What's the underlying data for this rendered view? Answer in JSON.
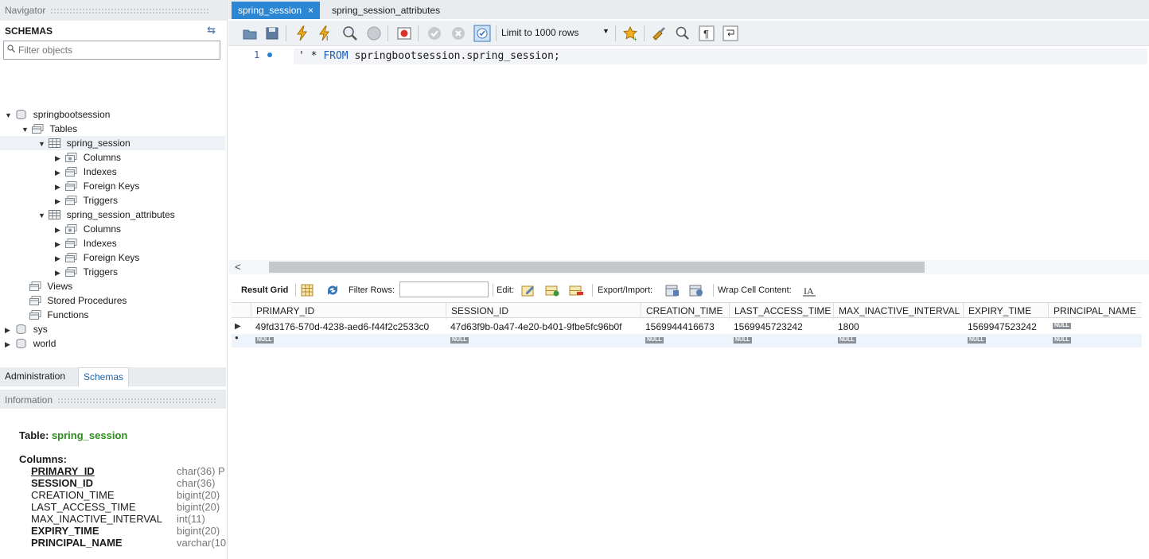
{
  "navigator": {
    "title": "Navigator",
    "schemas_label": "SCHEMAS",
    "filter_placeholder": "Filter objects",
    "tree": {
      "db1": "springbootsession",
      "tables": "Tables",
      "t1": "spring_session",
      "t1_children": [
        "Columns",
        "Indexes",
        "Foreign Keys",
        "Triggers"
      ],
      "t2": "spring_session_attributes",
      "t2_children": [
        "Columns",
        "Indexes",
        "Foreign Keys",
        "Triggers"
      ],
      "views": "Views",
      "procs": "Stored Procedures",
      "funcs": "Functions",
      "db2": "sys",
      "db3": "world"
    },
    "bottom_tabs": [
      "Administration",
      "Schemas"
    ],
    "info_title": "Information"
  },
  "info": {
    "table_label": "Table:",
    "table_name": "spring_session",
    "columns_label": "Columns:",
    "columns": [
      {
        "name": "PRIMARY_ID",
        "type": "char(36) P"
      },
      {
        "name": "SESSION_ID",
        "type": "char(36)"
      },
      {
        "name": "CREATION_TIME",
        "type": "bigint(20)"
      },
      {
        "name": "LAST_ACCESS_TIME",
        "type": "bigint(20)"
      },
      {
        "name": "MAX_INACTIVE_INTERVAL",
        "type": "int(11)"
      },
      {
        "name": "EXPIRY_TIME",
        "type": "bigint(20)"
      },
      {
        "name": "PRINCIPAL_NAME",
        "type": "varchar(10"
      }
    ]
  },
  "tabs": [
    {
      "label": "spring_session",
      "close": "×"
    },
    {
      "label": "spring_session_attributes"
    }
  ],
  "toolbar": {
    "limit_label": "Limit to 1000 rows",
    "limit_arrow": "▼"
  },
  "editor": {
    "line_no": "1",
    "code_star": "' * ",
    "code_from": "FROM",
    "code_rest": " springbootsession.spring_session;"
  },
  "results": {
    "result_grid": "Result Grid",
    "filter_rows": "Filter Rows:",
    "edit": "Edit:",
    "export_import": "Export/Import:",
    "wrap": "Wrap Cell Content:",
    "columns": [
      "PRIMARY_ID",
      "SESSION_ID",
      "CREATION_TIME",
      "LAST_ACCESS_TIME",
      "MAX_INACTIVE_INTERVAL",
      "EXPIRY_TIME",
      "PRINCIPAL_NAME"
    ],
    "row1": [
      "49fd3176-570d-4238-aed6-f44f2c2533c0",
      "47d63f9b-0a47-4e20-b401-9fbe5fc96b0f",
      "1569944416673",
      "1569945723242",
      "1800",
      "1569947523242"
    ],
    "null_label": "NULL"
  },
  "colors": {
    "accent_tab": "#2b86d4",
    "table_name_green": "#2e8b1f"
  }
}
